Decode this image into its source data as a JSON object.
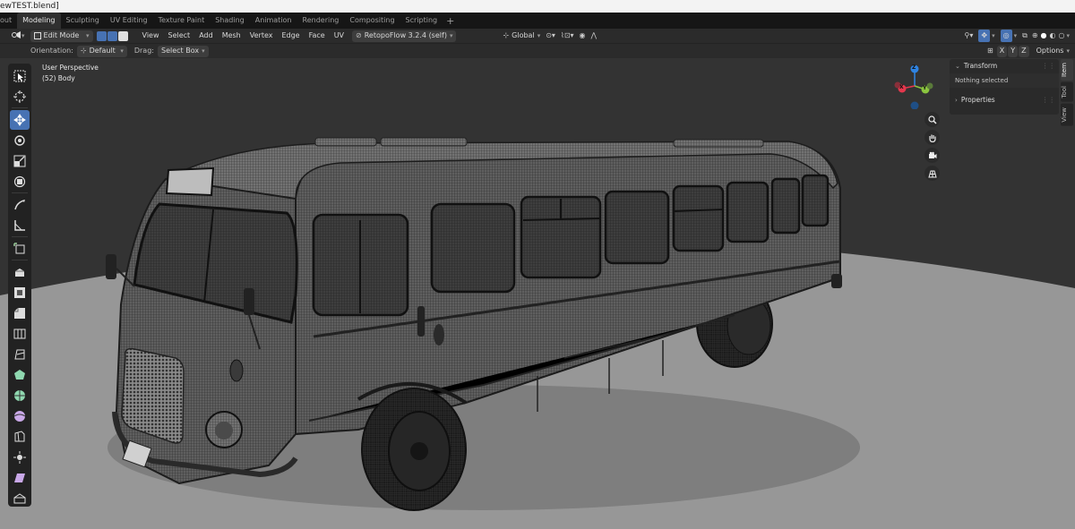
{
  "window": {
    "title": "ewTEST.blend]"
  },
  "workspaces": {
    "tabs": [
      "out",
      "Modeling",
      "Sculpting",
      "UV Editing",
      "Texture Paint",
      "Shading",
      "Animation",
      "Rendering",
      "Compositing",
      "Scripting"
    ],
    "active": "Modeling",
    "add_label": "+"
  },
  "header": {
    "mode": "Edit Mode",
    "menus": [
      "View",
      "Select",
      "Add",
      "Mesh",
      "Vertex",
      "Edge",
      "Face",
      "UV"
    ],
    "addon": "RetopoFlow 3.2.4 (self)",
    "transform_orientation": "Global"
  },
  "tool_settings": {
    "orientation_label": "Orientation:",
    "orientation_value": "Default",
    "drag_label": "Drag:",
    "drag_value": "Select Box",
    "options_label": "Options"
  },
  "viewport": {
    "perspective": "User Perspective",
    "object": "(52) Body"
  },
  "gizmo": {
    "x": "X",
    "y": "Y",
    "z": "Z"
  },
  "npanel": {
    "transform_label": "Transform",
    "nothing_selected": "Nothing selected",
    "properties_label": "Properties",
    "tabs": [
      "Item",
      "Tool",
      "View"
    ],
    "active_tab": "Item"
  },
  "toolbar": {
    "tools": [
      "select-box",
      "cursor",
      "move",
      "rotate",
      "scale",
      "transform",
      "annotate",
      "measure",
      "add-cube",
      "extrude",
      "inset",
      "bevel",
      "loop-cut",
      "knife",
      "poly-build",
      "spin",
      "smooth",
      "edge-slide",
      "shrink-fatten",
      "shear",
      "rip"
    ],
    "active": "move"
  },
  "colors": {
    "accent": "#4772b3",
    "axis_x": "#e5374d",
    "axis_y": "#8bc53f",
    "axis_z": "#2f84e3"
  }
}
